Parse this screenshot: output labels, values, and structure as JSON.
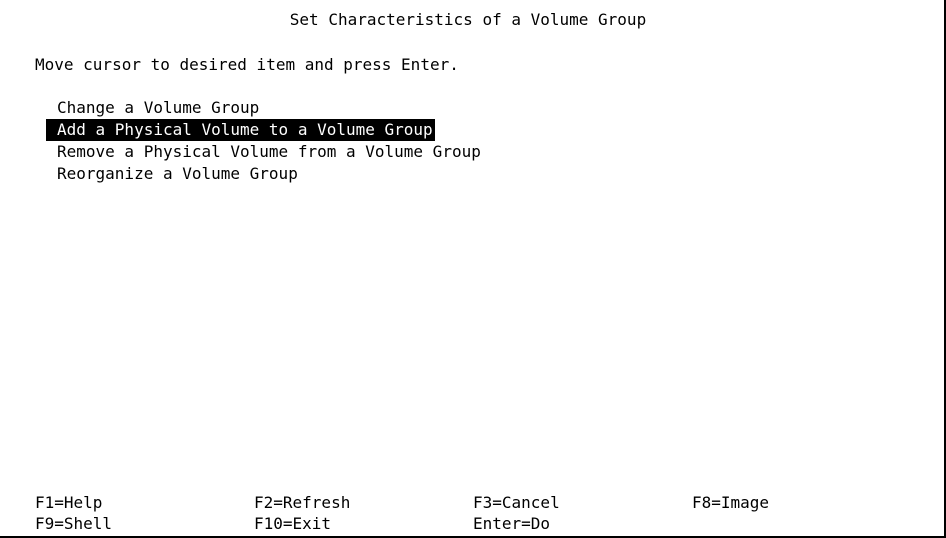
{
  "screen": {
    "title": "Set Characteristics of a Volume Group",
    "instructions": "Move cursor to desired item and press Enter."
  },
  "menu": {
    "items": [
      {
        "label": "Change a Volume Group",
        "selected": false
      },
      {
        "label": "Add a Physical Volume to a Volume Group",
        "selected": true
      },
      {
        "label": "Remove a Physical Volume from a Volume Group",
        "selected": false
      },
      {
        "label": "Reorganize a Volume Group",
        "selected": false
      }
    ]
  },
  "function_keys": {
    "row1": [
      "F1=Help",
      "F2=Refresh",
      "F3=Cancel",
      "F8=Image"
    ],
    "row2": [
      "F9=Shell",
      "F10=Exit",
      "Enter=Do"
    ]
  },
  "colors": {
    "background": "#ffffff",
    "text": "#000000",
    "selection_background": "#000000",
    "selection_text": "#ffffff"
  }
}
